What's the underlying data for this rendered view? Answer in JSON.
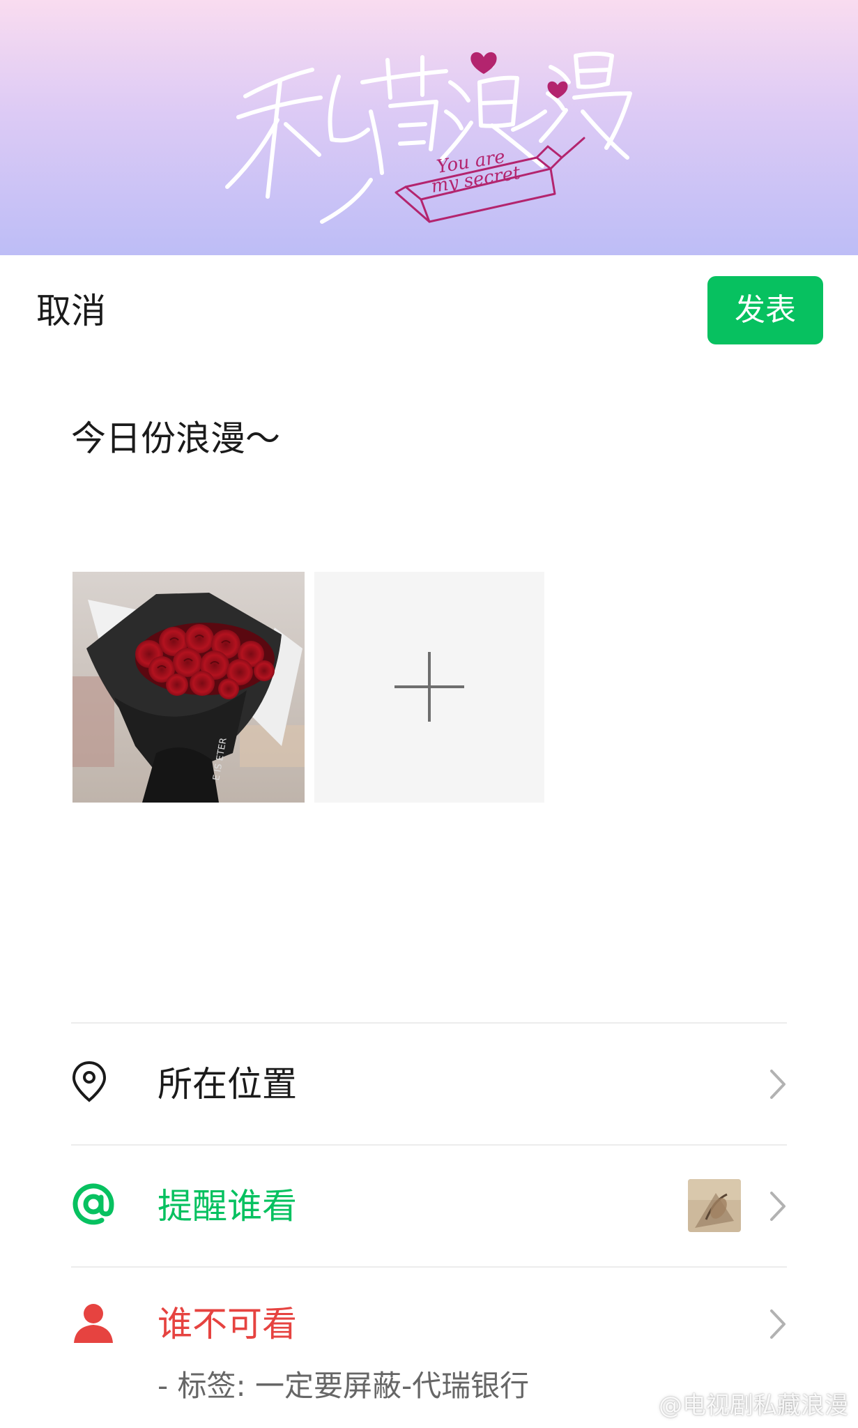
{
  "banner": {
    "logo_text": "私藏浪漫",
    "logo_subtitle": "You are my secret"
  },
  "header": {
    "cancel_label": "取消",
    "publish_label": "发表"
  },
  "post": {
    "text": "今日份浪漫～"
  },
  "photos": {
    "items": [
      {
        "icon": "rose-bouquet-photo"
      }
    ],
    "add_icon": "plus-icon"
  },
  "options": {
    "location": {
      "label": "所在位置",
      "icon": "location-pin-icon"
    },
    "mention": {
      "label": "提醒谁看",
      "icon": "at-icon"
    },
    "hidden_from": {
      "label": "谁不可看",
      "icon": "person-icon",
      "sublabel": "- 标签: 一定要屏蔽-代瑞银行"
    }
  },
  "watermark": {
    "text": "@电视剧私藏浪漫"
  },
  "colors": {
    "accent_green": "#07c160",
    "danger_red": "#e64340",
    "banner_top": "#f9dcf0",
    "banner_bottom": "#bdbdf6"
  }
}
